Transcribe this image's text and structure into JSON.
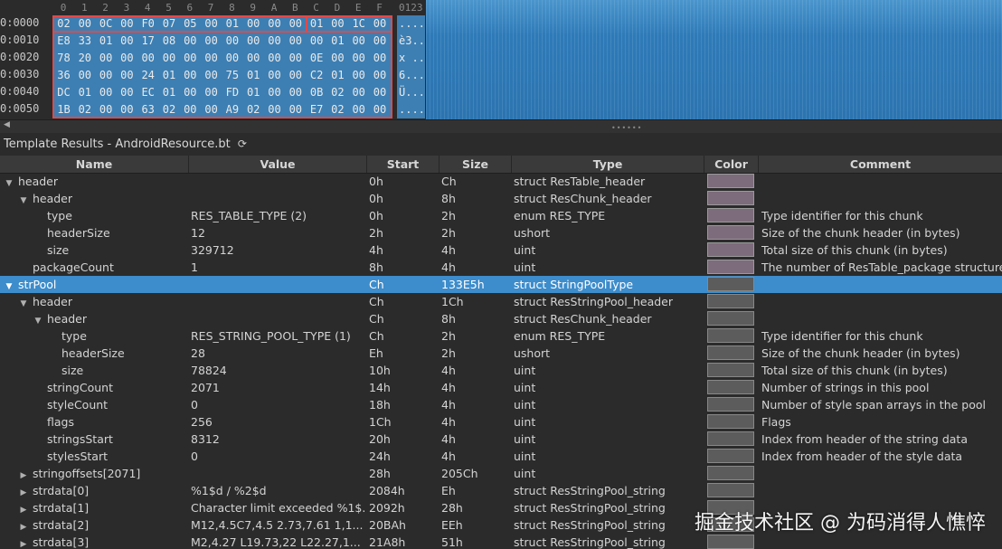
{
  "hex": {
    "col_headers": [
      "0",
      "1",
      "2",
      "3",
      "4",
      "5",
      "6",
      "7",
      "8",
      "9",
      "A",
      "B",
      "C",
      "D",
      "E",
      "F"
    ],
    "ascii_header": "0123",
    "rows": [
      {
        "addr": "0:0000",
        "bytes": [
          "02",
          "00",
          "0C",
          "00",
          "F0",
          "07",
          "05",
          "00",
          "01",
          "00",
          "00",
          "00",
          "01",
          "00",
          "1C",
          "00"
        ],
        "ascii": "...."
      },
      {
        "addr": "0:0010",
        "bytes": [
          "E8",
          "33",
          "01",
          "00",
          "17",
          "08",
          "00",
          "00",
          "00",
          "00",
          "00",
          "00",
          "00",
          "01",
          "00",
          "00"
        ],
        "ascii": "è3.."
      },
      {
        "addr": "0:0020",
        "bytes": [
          "78",
          "20",
          "00",
          "00",
          "00",
          "00",
          "00",
          "00",
          "00",
          "00",
          "00",
          "00",
          "0E",
          "00",
          "00",
          "00"
        ],
        "ascii": "x .."
      },
      {
        "addr": "0:0030",
        "bytes": [
          "36",
          "00",
          "00",
          "00",
          "24",
          "01",
          "00",
          "00",
          "75",
          "01",
          "00",
          "00",
          "C2",
          "01",
          "00",
          "00"
        ],
        "ascii": "6..."
      },
      {
        "addr": "0:0040",
        "bytes": [
          "DC",
          "01",
          "00",
          "00",
          "EC",
          "01",
          "00",
          "00",
          "FD",
          "01",
          "00",
          "00",
          "0B",
          "02",
          "00",
          "00"
        ],
        "ascii": "Ü..."
      },
      {
        "addr": "0:0050",
        "bytes": [
          "1B",
          "02",
          "00",
          "00",
          "63",
          "02",
          "00",
          "00",
          "A9",
          "02",
          "00",
          "00",
          "E7",
          "02",
          "00",
          "00"
        ],
        "ascii": "...."
      }
    ]
  },
  "template": {
    "title": "Template Results - AndroidResource.bt",
    "refresh_icon": "refresh-icon",
    "columns": [
      "Name",
      "Value",
      "Start",
      "Size",
      "Type",
      "Color",
      "Comment"
    ],
    "rows": [
      {
        "indent": 0,
        "tw": "open",
        "name": "header",
        "value": "",
        "start": "0h",
        "size": "Ch",
        "type": "struct ResTable_header",
        "comment": "",
        "sel": false
      },
      {
        "indent": 1,
        "tw": "open",
        "name": "header",
        "value": "",
        "start": "0h",
        "size": "8h",
        "type": "struct ResChunk_header",
        "comment": "",
        "sel": false
      },
      {
        "indent": 2,
        "tw": "",
        "name": "type",
        "value": "RES_TABLE_TYPE (2)",
        "start": "0h",
        "size": "2h",
        "type": "enum RES_TYPE",
        "comment": "Type identifier for this chunk",
        "sel": false
      },
      {
        "indent": 2,
        "tw": "",
        "name": "headerSize",
        "value": "12",
        "start": "2h",
        "size": "2h",
        "type": "ushort",
        "comment": "Size of the chunk header (in bytes)",
        "sel": false
      },
      {
        "indent": 2,
        "tw": "",
        "name": "size",
        "value": "329712",
        "start": "4h",
        "size": "4h",
        "type": "uint",
        "comment": "Total size of this chunk (in bytes)",
        "sel": false
      },
      {
        "indent": 1,
        "tw": "",
        "name": "packageCount",
        "value": "1",
        "start": "8h",
        "size": "4h",
        "type": "uint",
        "comment": "The number of ResTable_package structures",
        "sel": false
      },
      {
        "indent": 0,
        "tw": "open",
        "name": "strPool",
        "value": "",
        "start": "Ch",
        "size": "133E5h",
        "type": "struct StringPoolType",
        "comment": "",
        "sel": true
      },
      {
        "indent": 1,
        "tw": "open",
        "name": "header",
        "value": "",
        "start": "Ch",
        "size": "1Ch",
        "type": "struct ResStringPool_header",
        "comment": "",
        "sel": false
      },
      {
        "indent": 2,
        "tw": "open",
        "name": "header",
        "value": "",
        "start": "Ch",
        "size": "8h",
        "type": "struct ResChunk_header",
        "comment": "",
        "sel": false
      },
      {
        "indent": 3,
        "tw": "",
        "name": "type",
        "value": "RES_STRING_POOL_TYPE (1)",
        "start": "Ch",
        "size": "2h",
        "type": "enum RES_TYPE",
        "comment": "Type identifier for this chunk",
        "sel": false
      },
      {
        "indent": 3,
        "tw": "",
        "name": "headerSize",
        "value": "28",
        "start": "Eh",
        "size": "2h",
        "type": "ushort",
        "comment": "Size of the chunk header (in bytes)",
        "sel": false
      },
      {
        "indent": 3,
        "tw": "",
        "name": "size",
        "value": "78824",
        "start": "10h",
        "size": "4h",
        "type": "uint",
        "comment": "Total size of this chunk (in bytes)",
        "sel": false
      },
      {
        "indent": 2,
        "tw": "",
        "name": "stringCount",
        "value": "2071",
        "start": "14h",
        "size": "4h",
        "type": "uint",
        "comment": "Number of strings in this pool",
        "sel": false
      },
      {
        "indent": 2,
        "tw": "",
        "name": "styleCount",
        "value": "0",
        "start": "18h",
        "size": "4h",
        "type": "uint",
        "comment": "Number of style span arrays in the pool",
        "sel": false
      },
      {
        "indent": 2,
        "tw": "",
        "name": "flags",
        "value": "256",
        "start": "1Ch",
        "size": "4h",
        "type": "uint",
        "comment": "Flags",
        "sel": false
      },
      {
        "indent": 2,
        "tw": "",
        "name": "stringsStart",
        "value": "8312",
        "start": "20h",
        "size": "4h",
        "type": "uint",
        "comment": "Index from header of the string data",
        "sel": false
      },
      {
        "indent": 2,
        "tw": "",
        "name": "stylesStart",
        "value": "0",
        "start": "24h",
        "size": "4h",
        "type": "uint",
        "comment": "Index from header of the style data",
        "sel": false
      },
      {
        "indent": 1,
        "tw": "closed",
        "name": "stringoffsets[2071]",
        "value": "",
        "start": "28h",
        "size": "205Ch",
        "type": "uint",
        "comment": "",
        "sel": false
      },
      {
        "indent": 1,
        "tw": "closed",
        "name": "strdata[0]",
        "value": "%1$d / %2$d",
        "start": "2084h",
        "size": "Eh",
        "type": "struct ResStringPool_string",
        "comment": "",
        "sel": false
      },
      {
        "indent": 1,
        "tw": "closed",
        "name": "strdata[1]",
        "value": "Character limit exceeded %1$...",
        "start": "2092h",
        "size": "28h",
        "type": "struct ResStringPool_string",
        "comment": "",
        "sel": false
      },
      {
        "indent": 1,
        "tw": "closed",
        "name": "strdata[2]",
        "value": "M12,4.5C7,4.5 2.73,7.61 1,1...",
        "start": "20BAh",
        "size": "EEh",
        "type": "struct ResStringPool_string",
        "comment": "",
        "sel": false
      },
      {
        "indent": 1,
        "tw": "closed",
        "name": "strdata[3]",
        "value": "M2,4.27 L19.73,22 L22.27,1...",
        "start": "21A8h",
        "size": "51h",
        "type": "struct ResStringPool_string",
        "comment": "",
        "sel": false
      }
    ]
  },
  "colors": {
    "hex_selection": "#3d7fb3",
    "row_selection": "#3d8ccb",
    "highlight_box": "#e04a4a",
    "swatch": "#7d6c7c"
  },
  "watermark": "掘金技术社区 @ 为码消得人憔悴"
}
